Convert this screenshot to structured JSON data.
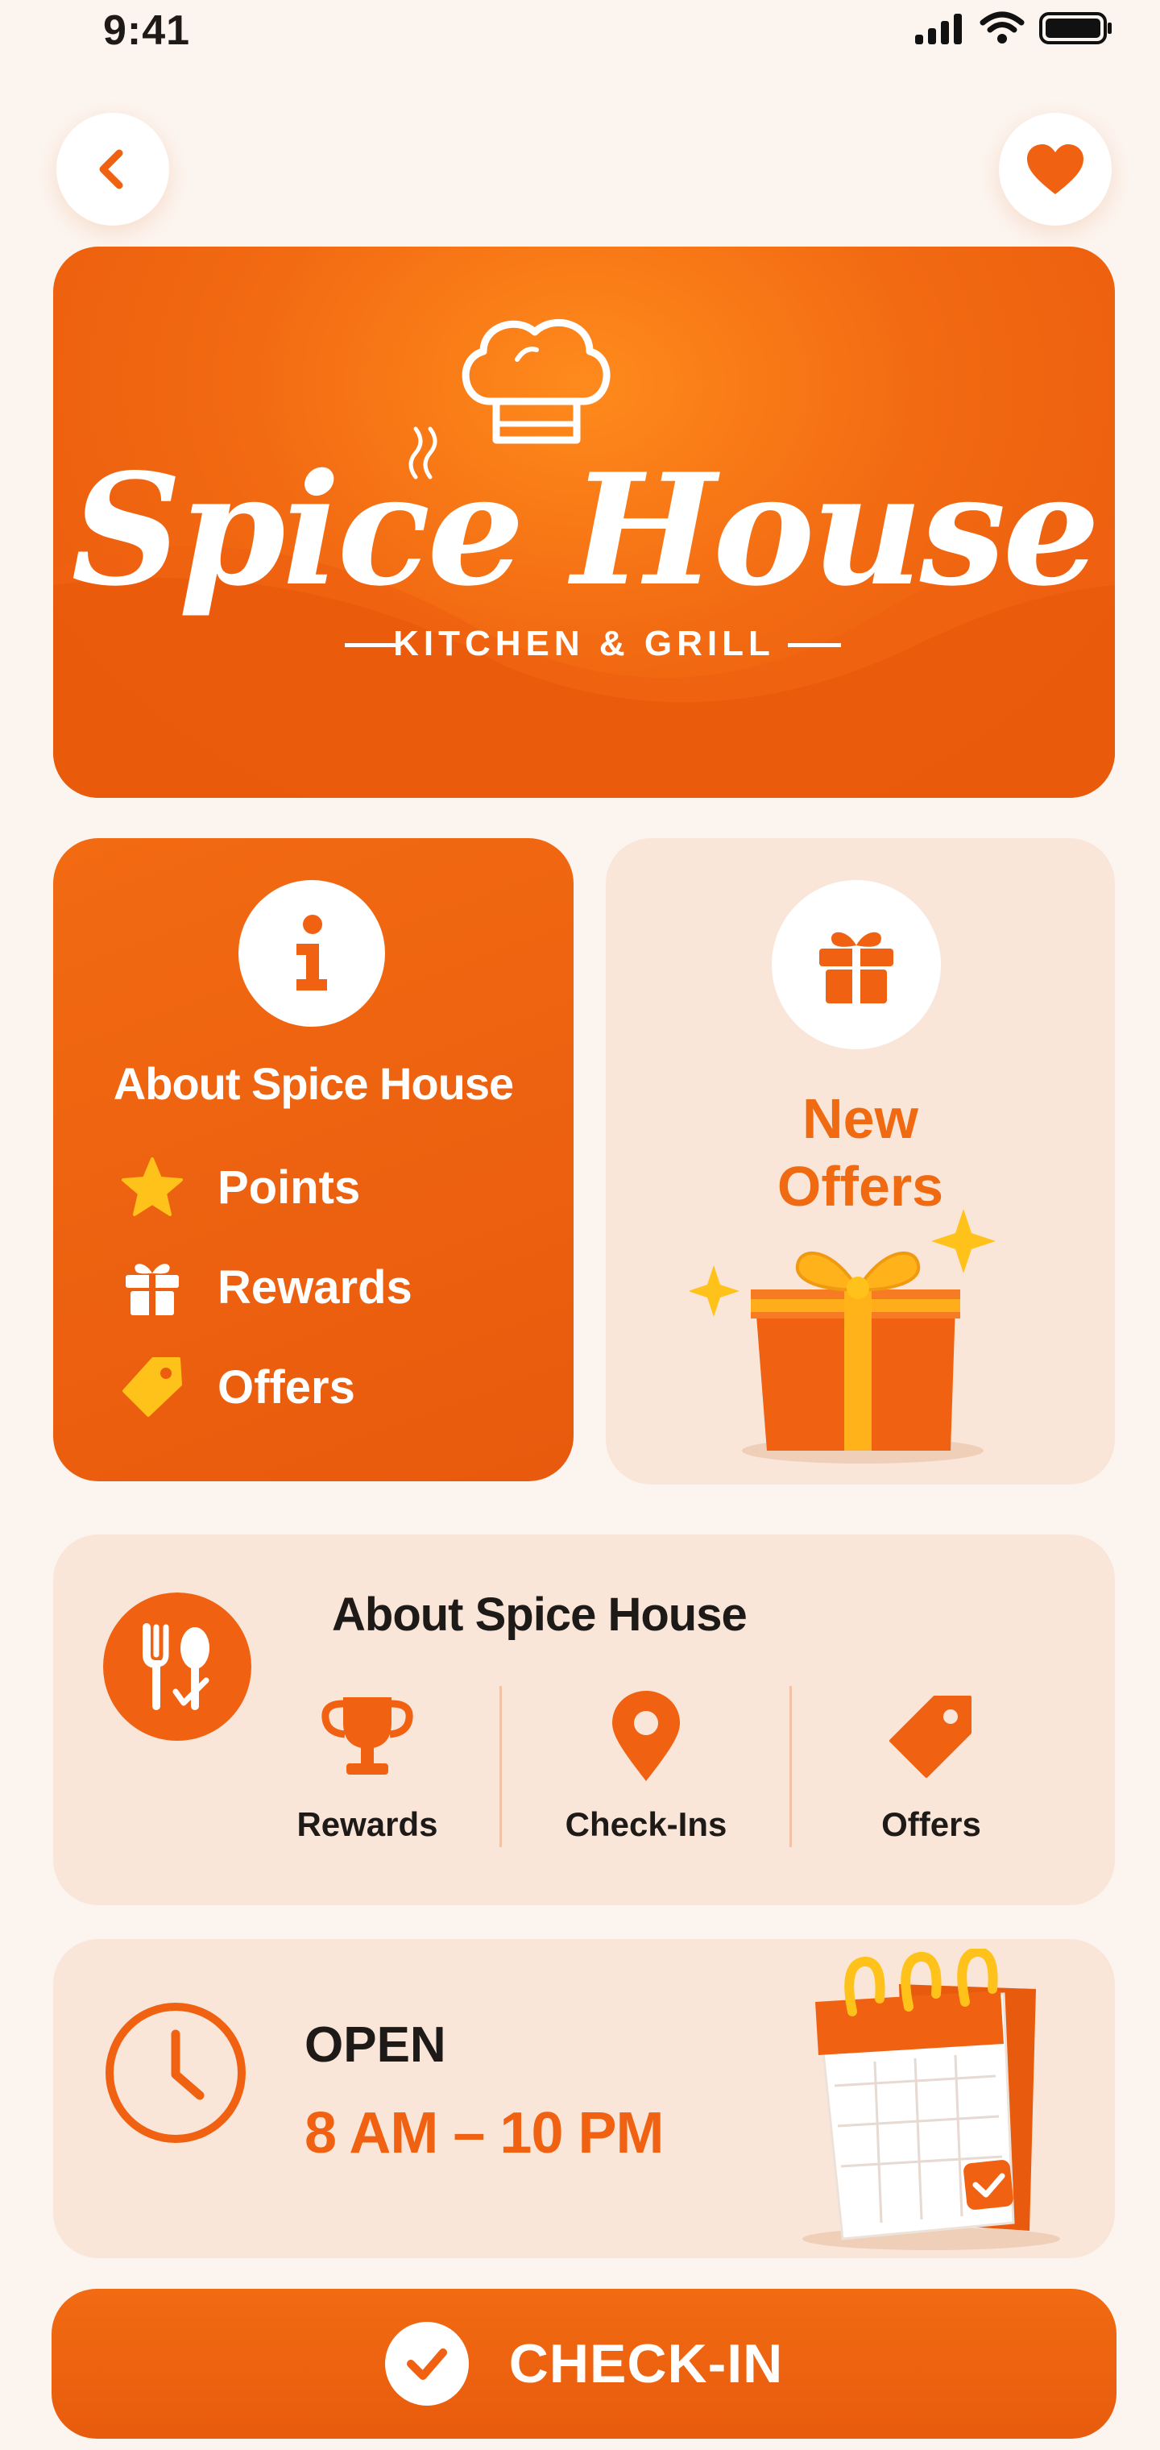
{
  "status_bar": {
    "time": "9:41"
  },
  "nav": {
    "back_icon": "chevron-left-icon",
    "favorite_icon": "heart-icon"
  },
  "hero": {
    "title": "Spice House",
    "subtitle": "KITCHEN & GRILL",
    "logo_icon": "chef-hat-icon"
  },
  "about_card": {
    "icon": "info-icon",
    "title": "About Spice House",
    "items": [
      {
        "icon": "star-icon",
        "label": "Points"
      },
      {
        "icon": "gift-icon",
        "label": "Rewards"
      },
      {
        "icon": "tag-icon",
        "label": "Offers"
      }
    ]
  },
  "offers_card": {
    "icon": "gift-icon",
    "title_line1": "New",
    "title_line2": "Offers"
  },
  "stats_card": {
    "icon": "cutlery-icon",
    "title": "About  Spice House",
    "items": [
      {
        "icon": "trophy-icon",
        "label": "Rewards"
      },
      {
        "icon": "location-pin-icon",
        "label": "Check-Ins"
      },
      {
        "icon": "tag-icon",
        "label": "Offers"
      }
    ]
  },
  "hours_card": {
    "icon": "clock-icon",
    "status": "OPEN",
    "hours": "8 AM – 10 PM"
  },
  "checkin_button": {
    "label": "CHECK-IN",
    "icon": "check-icon"
  },
  "colors": {
    "accent": "#F06212",
    "card_bg": "#FAE6D9",
    "page_bg": "#FCF4EE",
    "gold": "#FFC21A"
  }
}
